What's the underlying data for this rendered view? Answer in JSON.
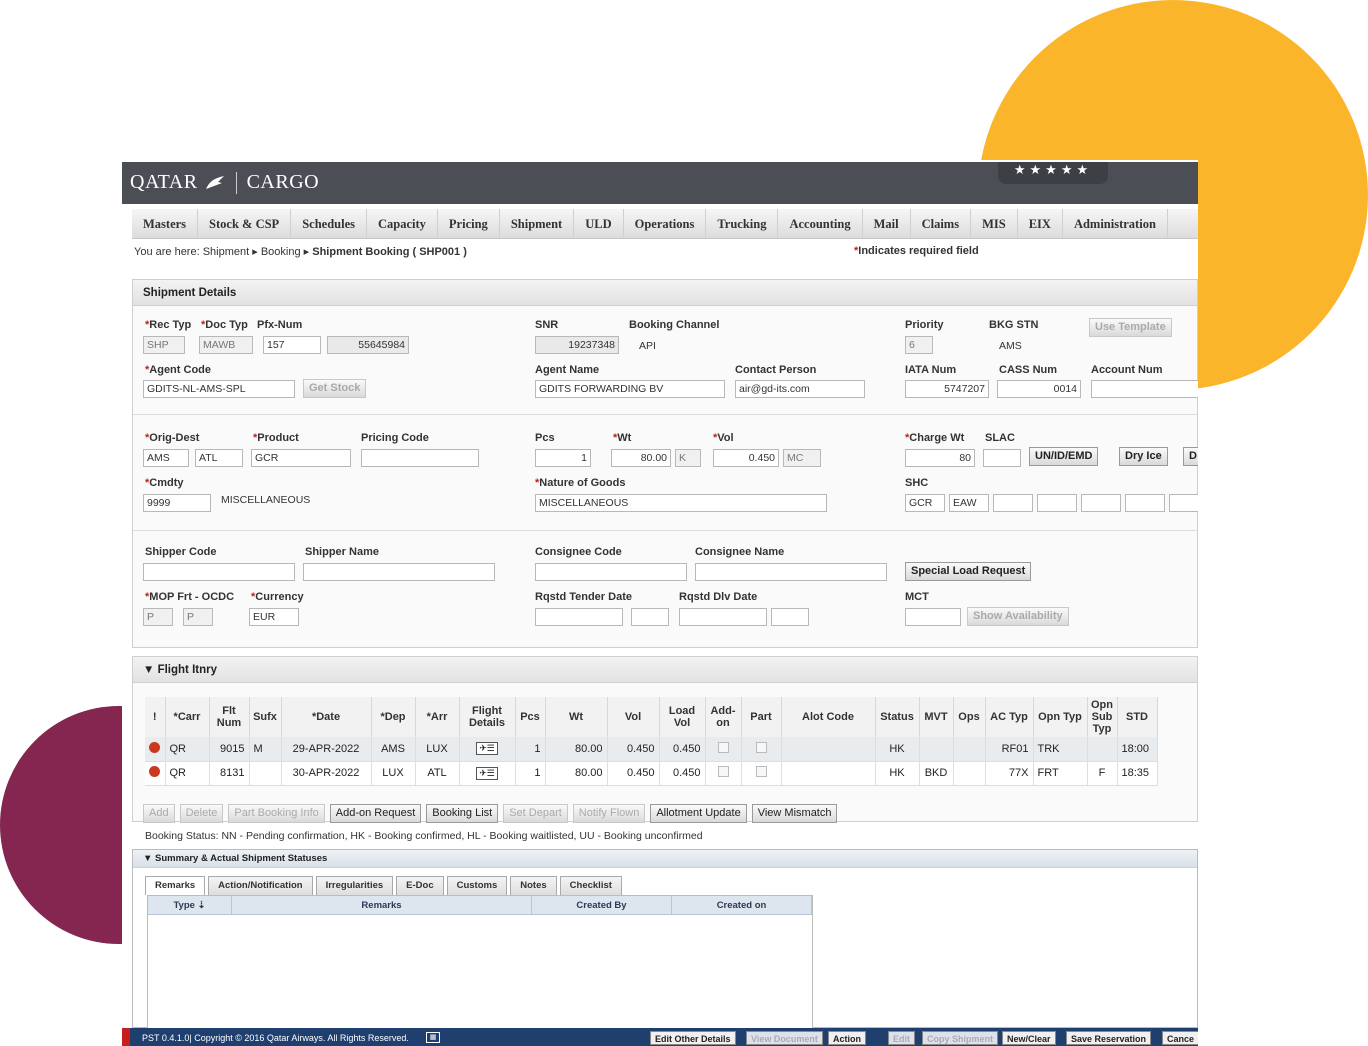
{
  "brand": {
    "left": "QATAR",
    "right": "CARGO",
    "stars": "★★★★★"
  },
  "menu": [
    "Masters",
    "Stock & CSP",
    "Schedules",
    "Capacity",
    "Pricing",
    "Shipment",
    "ULD",
    "Operations",
    "Trucking",
    "Accounting",
    "Mail",
    "Claims",
    "MIS",
    "EIX",
    "Administration"
  ],
  "breadcrumb": {
    "prefix": "You are here:",
    "items": [
      "Shipment",
      "Booking"
    ],
    "current": "Shipment Booking ( SHP001 )"
  },
  "required_note": "Indicates required field",
  "shipment": {
    "title": "Shipment Details",
    "labels": {
      "rec_typ": "Rec Typ",
      "doc_typ": "Doc Typ",
      "pfx_num": "Pfx-Num",
      "snr": "SNR",
      "booking_channel": "Booking Channel",
      "priority": "Priority",
      "bkg_stn": "BKG STN",
      "agent_code": "Agent Code",
      "agent_name": "Agent Name",
      "contact_person": "Contact Person",
      "iata_num": "IATA Num",
      "cass_num": "CASS Num",
      "account_num": "Account Num",
      "orig_dest": "Orig-Dest",
      "product": "Product",
      "pricing_code": "Pricing Code",
      "pcs": "Pcs",
      "wt": "Wt",
      "vol": "Vol",
      "charge_wt": "Charge Wt",
      "slac": "SLAC",
      "cmdty": "Cmdty",
      "nature_of_goods": "Nature of Goods",
      "shc": "SHC",
      "shipper_code": "Shipper Code",
      "shipper_name": "Shipper Name",
      "consignee_code": "Consignee Code",
      "consignee_name": "Consignee Name",
      "mop": "MOP Frt - OCDC",
      "currency": "Currency",
      "rqstd_tender": "Rqstd Tender Date",
      "rqstd_dlv": "Rqstd Dlv Date",
      "mct": "MCT"
    },
    "values": {
      "rec_typ": "SHP",
      "doc_typ": "MAWB",
      "pfx": "157",
      "num": "55645984",
      "snr": "19237348",
      "booking_channel": "API",
      "priority": "6",
      "bkg_stn": "AMS",
      "agent_code": "GDITS-NL-AMS-SPL",
      "agent_name": "GDITS FORWARDING BV",
      "contact_person": "air@gd-its.com",
      "iata_num": "5747207",
      "cass_num": "0014",
      "orig": "AMS",
      "dest": "ATL",
      "product": "GCR",
      "pcs": "1",
      "wt": "80.00",
      "wt_unit": "K",
      "vol": "0.450",
      "vol_unit": "MC",
      "charge_wt": "80",
      "cmdty": "9999",
      "cmdty_desc": "MISCELLANEOUS",
      "nature_of_goods": "MISCELLANEOUS",
      "shc1": "GCR",
      "shc2": "EAW",
      "mop_frt": "P",
      "mop_ocdc": "P",
      "currency": "EUR"
    },
    "buttons": {
      "use_template": "Use Template",
      "get_stock": "Get Stock",
      "un_id": "UN/ID/EMD",
      "dry_ice": "Dry Ice",
      "d": "D",
      "special_load": "Special Load Request",
      "show_avail": "Show Availability"
    }
  },
  "flight": {
    "title": "Flight Itnry",
    "headers": [
      "!",
      "*Carr",
      "Flt Num",
      "Sufx",
      "*Date",
      "*Dep",
      "*Arr",
      "Flight Details",
      "Pcs",
      "Wt",
      "Vol",
      "Load Vol",
      "Add-on",
      "Part",
      "Alot Code",
      "Status",
      "MVT",
      "Ops",
      "AC Typ",
      "Opn Typ",
      "Opn Sub Typ",
      "STD"
    ],
    "rows": [
      {
        "carr": "QR",
        "flt": "9015",
        "sufx": "M",
        "date": "29-APR-2022",
        "dep": "AMS",
        "arr": "LUX",
        "pcs": "1",
        "wt": "80.00",
        "vol": "0.450",
        "load_vol": "0.450",
        "status": "HK",
        "mvt": "",
        "ac_typ": "RF01",
        "opn_typ": "TRK",
        "opn_sub": "",
        "std": "18:00"
      },
      {
        "carr": "QR",
        "flt": "8131",
        "sufx": "",
        "date": "30-APR-2022",
        "dep": "LUX",
        "arr": "ATL",
        "pcs": "1",
        "wt": "80.00",
        "vol": "0.450",
        "load_vol": "0.450",
        "status": "HK",
        "mvt": "BKD",
        "ac_typ": "77X",
        "opn_typ": "FRT",
        "opn_sub": "F",
        "std": "18:35"
      }
    ],
    "buttons": [
      "Add",
      "Delete",
      "Part Booking Info",
      "Add-on Request",
      "Booking List",
      "Set Depart",
      "Notify Flown",
      "Allotment Update",
      "View Mismatch"
    ],
    "status_note": "Booking Status: NN - Pending confirmation, HK - Booking confirmed, HL - Booking waitlisted, UU - Booking unconfirmed"
  },
  "summary": {
    "title": "Summary & Actual Shipment Statuses",
    "tabs": [
      "Remarks",
      "Action/Notification",
      "Irregularities",
      "E-Doc",
      "Customs",
      "Notes",
      "Checklist"
    ],
    "columns": [
      "Type",
      "Remarks",
      "Created By",
      "Created on"
    ]
  },
  "footer": {
    "text": "PST  0.4.1.0| Copyright © 2016 Qatar Airways. All Rights Reserved.",
    "buttons": [
      "Edit Other Details",
      "View Document",
      "Action",
      "Edit",
      "Copy Shipment",
      "New/Clear",
      "Save Reservation",
      "Cance"
    ]
  }
}
